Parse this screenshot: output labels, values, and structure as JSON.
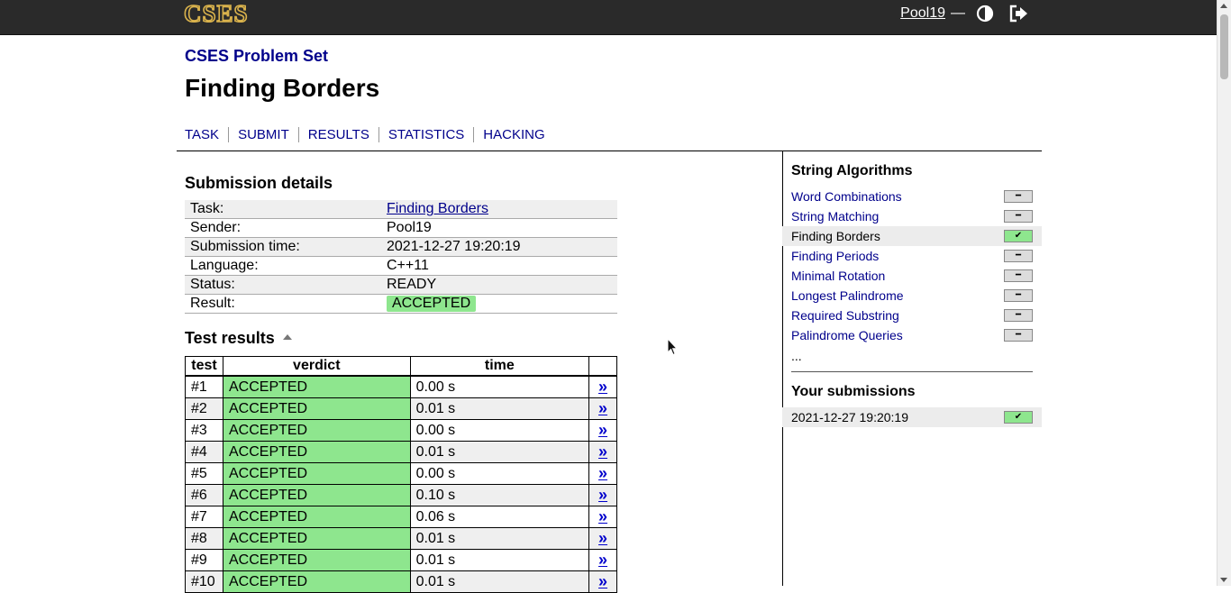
{
  "header": {
    "logo_text": "CSES",
    "username": "Pool19",
    "separator": "—"
  },
  "breadcrumb": "CSES Problem Set",
  "title": "Finding Borders",
  "tabs": [
    "TASK",
    "SUBMIT",
    "RESULTS",
    "STATISTICS",
    "HACKING"
  ],
  "submission": {
    "heading": "Submission details",
    "rows": [
      {
        "label": "Task:",
        "value": "Finding Borders"
      },
      {
        "label": "Sender:",
        "value": "Pool19"
      },
      {
        "label": "Submission time:",
        "value": "2021-12-27 19:20:19"
      },
      {
        "label": "Language:",
        "value": "C++11"
      },
      {
        "label": "Status:",
        "value": "READY"
      },
      {
        "label": "Result:",
        "value": "ACCEPTED"
      }
    ]
  },
  "test_results": {
    "heading": "Test results",
    "columns": [
      "test",
      "verdict",
      "time",
      ""
    ],
    "view_link": "»",
    "rows": [
      {
        "test": "#1",
        "verdict": "ACCEPTED",
        "time": "0.00 s"
      },
      {
        "test": "#2",
        "verdict": "ACCEPTED",
        "time": "0.01 s"
      },
      {
        "test": "#3",
        "verdict": "ACCEPTED",
        "time": "0.00 s"
      },
      {
        "test": "#4",
        "verdict": "ACCEPTED",
        "time": "0.01 s"
      },
      {
        "test": "#5",
        "verdict": "ACCEPTED",
        "time": "0.00 s"
      },
      {
        "test": "#6",
        "verdict": "ACCEPTED",
        "time": "0.10 s"
      },
      {
        "test": "#7",
        "verdict": "ACCEPTED",
        "time": "0.06 s"
      },
      {
        "test": "#8",
        "verdict": "ACCEPTED",
        "time": "0.01 s"
      },
      {
        "test": "#9",
        "verdict": "ACCEPTED",
        "time": "0.01 s"
      },
      {
        "test": "#10",
        "verdict": "ACCEPTED",
        "time": "0.01 s"
      }
    ]
  },
  "sidebar": {
    "section_title": "String Algorithms",
    "problems": [
      {
        "name": "Word Combinations",
        "status": "unsolved",
        "current": false
      },
      {
        "name": "String Matching",
        "status": "unsolved",
        "current": false
      },
      {
        "name": "Finding Borders",
        "status": "solved",
        "current": true
      },
      {
        "name": "Finding Periods",
        "status": "unsolved",
        "current": false
      },
      {
        "name": "Minimal Rotation",
        "status": "unsolved",
        "current": false
      },
      {
        "name": "Longest Palindrome",
        "status": "unsolved",
        "current": false
      },
      {
        "name": "Required Substring",
        "status": "unsolved",
        "current": false
      },
      {
        "name": "Palindrome Queries",
        "status": "unsolved",
        "current": false
      }
    ],
    "more": "...",
    "submissions_title": "Your submissions",
    "submissions": [
      {
        "time": "2021-12-27 19:20:19",
        "status": "solved"
      }
    ]
  },
  "colors": {
    "accepted": "#8ee68e",
    "link": "#00008b",
    "header_bg": "#2a2a2a"
  }
}
